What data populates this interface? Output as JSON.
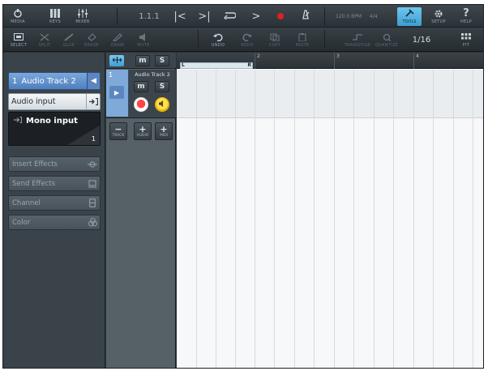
{
  "toolbar": {
    "media_label": "MEDIA",
    "keys_label": "KEYS",
    "mixer_label": "MIXER",
    "position": "1.1.1",
    "tempo": "120.0 BPM",
    "signature": "4/4",
    "tools_label": "TOOLS",
    "setup_label": "SETUP",
    "help_label": "HELP",
    "select_label": "SELECT",
    "split_label": "SPLIT",
    "glue_label": "GLUE",
    "erase_label": "ERASE",
    "draw_label": "DRAW",
    "mute_label": "MUTE",
    "undo_label": "UNDO",
    "redo_label": "REDO",
    "copy_label": "COPY",
    "paste_label": "PASTE",
    "transpose_label": "TRANSPOSE",
    "quantize_label": "QUANTIZE",
    "quantize_value": "1/16",
    "fit_label": "FIT"
  },
  "inspector": {
    "track_number": "1",
    "track_name": "Audio Track 2",
    "input_label": "Audio input",
    "input_name": "Mono input",
    "input_channel": "1",
    "sections": [
      "Insert Effects",
      "Send Effects",
      "Channel",
      "Color"
    ]
  },
  "tracklist": {
    "m_label": "m",
    "s_label": "S",
    "track_number": "1",
    "track_name": "Audio Track 2",
    "add_track_label": "TRACK",
    "add_audio_label": "AUDIO",
    "add_midi_label": "MIDI"
  },
  "ruler": {
    "bars": [
      "2",
      "3",
      "4"
    ],
    "loop_left": "L",
    "loop_right": "R"
  },
  "colors": {
    "accent": "#4f9fd4",
    "track_blue": "#6f9bd3",
    "record_red": "#ff4444",
    "monitor_yellow": "#ffd43b"
  }
}
